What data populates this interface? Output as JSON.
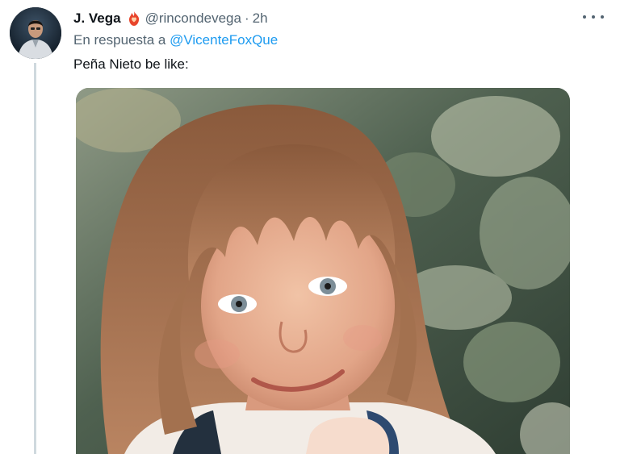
{
  "tweet": {
    "display_name": "J. Vega",
    "badge_icon": "flame-heart-icon",
    "handle": "@rincondevega",
    "separator": "·",
    "time": "2h",
    "reply_prefix": "En respuesta a",
    "reply_to": "@VicenteFoxQue",
    "text": "Peña Nieto be like:",
    "media_description_icon": "photo-child-portrait",
    "more_icon": "more-options-icon"
  },
  "colors": {
    "link": "#1d9bf0",
    "secondary_text": "#536471",
    "primary_text": "#0f1419",
    "thread_line": "#cfd9de"
  }
}
